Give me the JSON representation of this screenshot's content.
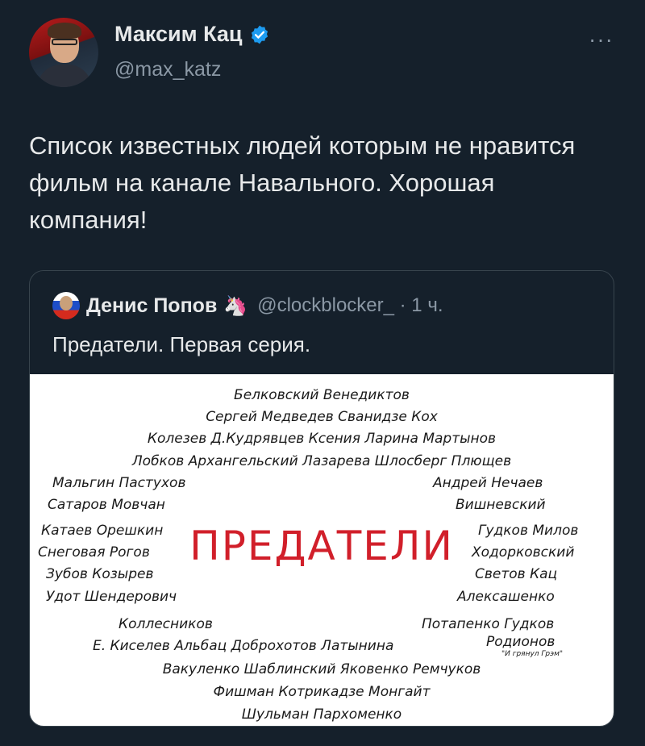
{
  "author": {
    "display_name": "Максим Кац",
    "handle": "@max_katz",
    "verified": true,
    "avatar_icon": "profile-photo"
  },
  "menu": {
    "more_label": "···"
  },
  "tweet": {
    "text": "Список известных людей которым не нравится фильм на канале Навального. Хорошая компания!"
  },
  "quote": {
    "author_name": "Денис Попов",
    "author_emoji": "🦄",
    "handle_time": "@clockblocker_ · 1 ч.",
    "text": "Предатели. Первая серия.",
    "image": {
      "title": "ПРЕДАТЕЛИ",
      "lines": [
        "Белковский  Венедиктов",
        "Сергей Медведев   Сванидзе   Кох",
        "Колезев Д.Кудрявцев  Ксения Ларина  Мартынов",
        "Лобков  Архангельский   Лазарева    Шлосберг  Плющев",
        "Мальгин Пастухов",
        "Андрей Нечаев",
        "Сатаров  Мовчан",
        "Вишневский",
        "Катаев Орешкин",
        "Гудков  Милов",
        "Снеговая     Рогов",
        "Ходорковский",
        "Зубов  Козырев",
        "Светов   Кац",
        "Удот  Шендерович",
        "Алексашенко",
        "Коллесников",
        "Потапенко  Гудков",
        "Е. Киселев  Альбац    Доброхотов  Латынина",
        "Родионов",
        "\"И грянул Грэм\"",
        "Вакуленко  Шаблинский  Яковенко  Ремчуков",
        "Фишман  Котрикадзе  Монгайт",
        "Шульман   Пархоменко"
      ]
    }
  },
  "colors": {
    "background": "#15202b",
    "text": "#e7e9ea",
    "muted": "#8b98a5",
    "verified": "#1d9bf0",
    "accent_red": "#d11f2a"
  }
}
